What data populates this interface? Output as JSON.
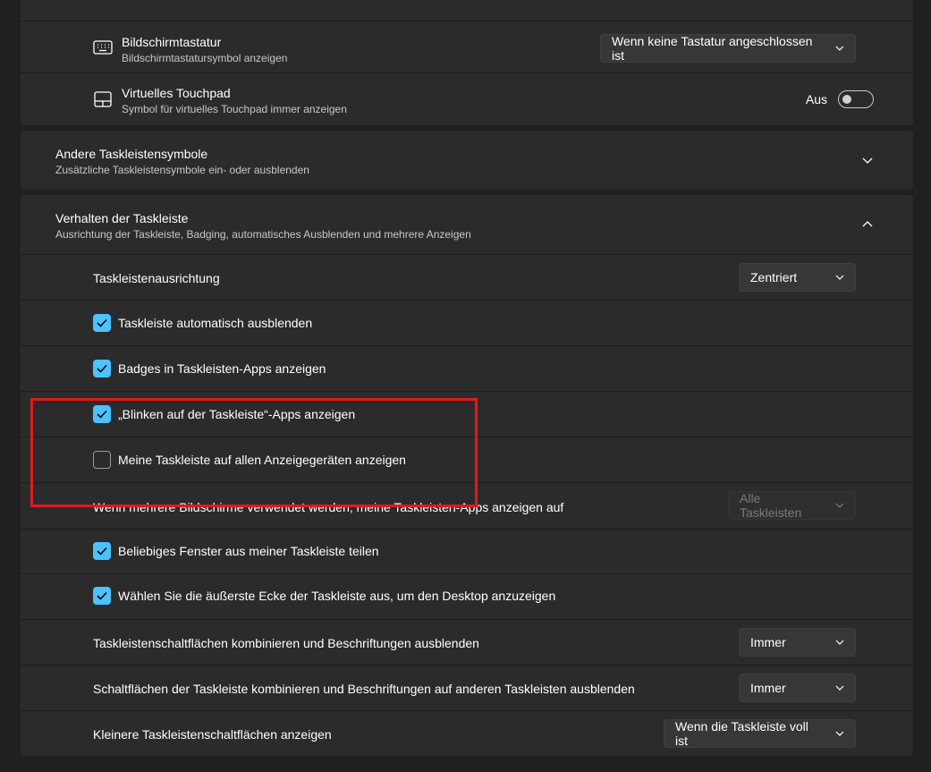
{
  "top_panel": {
    "keyboard": {
      "title": "Bildschirmtastatur",
      "subtitle": "Bildschirmtastatursymbol anzeigen",
      "dropdown_value": "Wenn keine Tastatur angeschlossen ist"
    },
    "touchpad": {
      "title": "Virtuelles Touchpad",
      "subtitle": "Symbol für virtuelles Touchpad immer anzeigen",
      "toggle_label": "Aus",
      "toggle_on": false
    }
  },
  "other_icons": {
    "title": "Andere Taskleistensymbole",
    "subtitle": "Zusätzliche Taskleistensymbole ein- oder ausblenden",
    "expanded": false
  },
  "behavior": {
    "title": "Verhalten der Taskleiste",
    "subtitle": "Ausrichtung der Taskleiste, Badging, automatisches Ausblenden und mehrere Anzeigen",
    "expanded": true,
    "alignment": {
      "label": "Taskleistenausrichtung",
      "value": "Zentriert"
    },
    "auto_hide": {
      "label": "Taskleiste automatisch ausblenden",
      "checked": true
    },
    "badges": {
      "label": "Badges in Taskleisten-Apps anzeigen",
      "checked": true
    },
    "flashing": {
      "label": "„Blinken auf der Taskleiste“-Apps anzeigen",
      "checked": true
    },
    "all_displays": {
      "label": "Meine Taskleiste auf allen Anzeigegeräten anzeigen",
      "checked": false
    },
    "multi_monitor": {
      "label": "Wenn mehrere Bildschirme verwendet werden, meine Taskleisten-Apps anzeigen auf",
      "value": "Alle Taskleisten",
      "disabled": true
    },
    "share_window": {
      "label": "Beliebiges Fenster aus meiner Taskleiste teilen",
      "checked": true
    },
    "far_corner": {
      "label": "Wählen Sie die äußerste Ecke der Taskleiste aus, um den Desktop anzuzeigen",
      "checked": true
    },
    "combine_buttons": {
      "label": "Taskleistenschaltflächen kombinieren und Beschriftungen ausblenden",
      "value": "Immer"
    },
    "combine_other": {
      "label": "Schaltflächen der Taskleiste kombinieren und Beschriftungen auf anderen Taskleisten ausblenden",
      "value": "Immer"
    },
    "smaller_buttons": {
      "label": "Kleinere Taskleistenschaltflächen anzeigen",
      "value": "Wenn die Taskleiste voll ist"
    }
  },
  "colors": {
    "accent": "#4cc2ff",
    "highlight_box": "#e01b1b",
    "card_bg": "#2b2b2b",
    "page_bg": "#202020"
  }
}
